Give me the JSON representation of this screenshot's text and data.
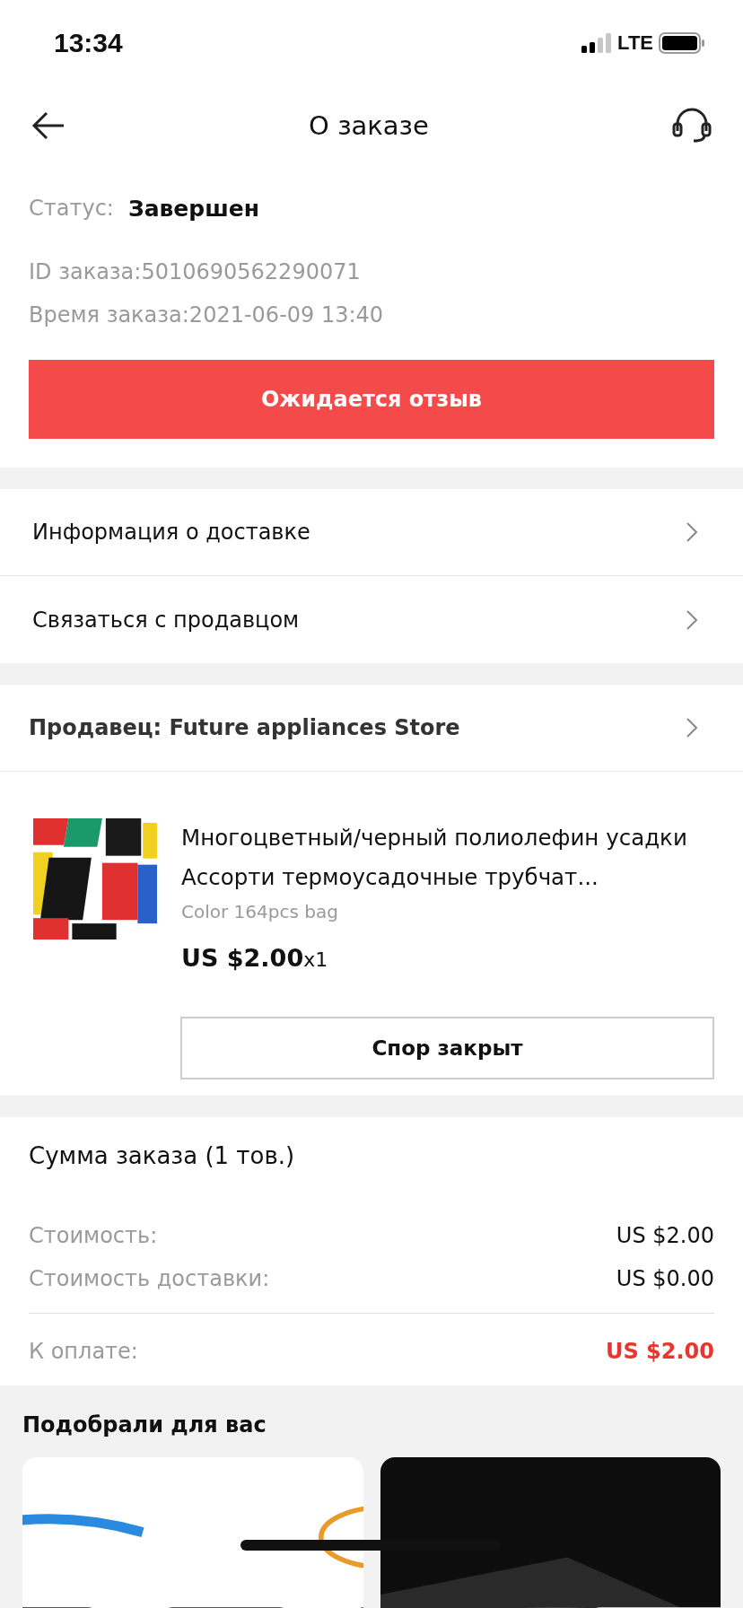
{
  "status_bar": {
    "time": "13:34",
    "network": "LTE"
  },
  "header": {
    "title": "О заказе"
  },
  "order": {
    "status_label": "Статус:",
    "status": "Завершен",
    "id": "ID заказа:5010690562290071",
    "time": "Время заказа:2021-06-09 13:40",
    "action": "Ожидается отзыв"
  },
  "links": [
    {
      "label": "Информация о доставке"
    },
    {
      "label": "Связаться с продавцом"
    }
  ],
  "seller": {
    "label": "Продавец: Future appliances Store"
  },
  "product": {
    "title": "Многоцветный/черный полиолефин усадки Ассорти термоусадочные трубчат...",
    "variant": "Color 164pcs bag",
    "price": "US $2.00",
    "quantity": "x1",
    "button": "Спор закрыт"
  },
  "summary": {
    "title": "Сумма заказа (1 тов.)",
    "rows": [
      {
        "label": "Стоимость:",
        "value": "US $2.00"
      },
      {
        "label": "Стоимость доставки:",
        "value": "US $0.00"
      }
    ],
    "total_label": "К оплате:",
    "total": "US $2.00"
  },
  "recommendations": {
    "title": "Подобрали для вас"
  }
}
